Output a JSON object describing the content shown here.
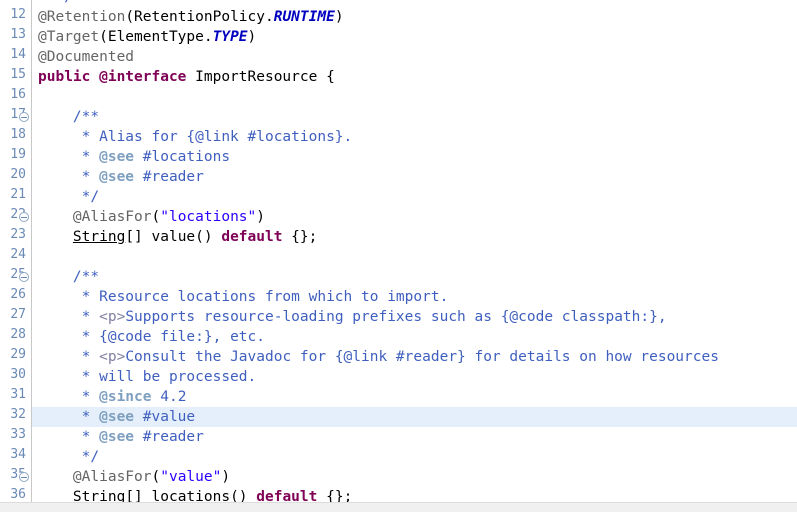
{
  "editor": {
    "name": "java-source-editor",
    "language": "Java",
    "font_size_px": 14.5,
    "line_height_px": 20,
    "current_line_number": "32",
    "colors": {
      "background": "#ffffff",
      "gutter_background": "#ffffff",
      "gutter_border": "#c8c8c8",
      "line_number": "#6a8ab5",
      "current_line_highlight": "#e4effb",
      "keyword": "#7f0055",
      "string": "#2a00ff",
      "annotation": "#646464",
      "static_field": "#0000c0",
      "comment": "#3f5fbf",
      "javadoc_tag": "#7f9fbf",
      "javadoc_html": "#7f7f9f",
      "plain_text": "#000000",
      "bottom_divider": "#f0f0f0"
    }
  },
  "lines": [
    {
      "number": "",
      "folding": false,
      "current": false,
      "clipped_top": true,
      "tokens": [
        {
          "t": "  ",
          "c": "plain"
        },
        {
          "t": "*/",
          "c": "comment"
        }
      ]
    },
    {
      "number": "12",
      "folding": false,
      "current": false,
      "tokens": [
        {
          "t": "@Retention",
          "c": "anno"
        },
        {
          "t": "(RetentionPolicy.",
          "c": "plain"
        },
        {
          "t": "RUNTIME",
          "c": "static"
        },
        {
          "t": ")",
          "c": "plain"
        }
      ]
    },
    {
      "number": "13",
      "folding": false,
      "current": false,
      "tokens": [
        {
          "t": "@Target",
          "c": "anno"
        },
        {
          "t": "(ElementType.",
          "c": "plain"
        },
        {
          "t": "TYPE",
          "c": "static"
        },
        {
          "t": ")",
          "c": "plain"
        }
      ]
    },
    {
      "number": "14",
      "folding": false,
      "current": false,
      "tokens": [
        {
          "t": "@Documented",
          "c": "anno"
        }
      ]
    },
    {
      "number": "15",
      "folding": false,
      "current": false,
      "tokens": [
        {
          "t": "public @interface",
          "c": "keyword"
        },
        {
          "t": " ImportResource {",
          "c": "plain"
        }
      ]
    },
    {
      "number": "16",
      "folding": false,
      "current": false,
      "tokens": []
    },
    {
      "number": "17",
      "folding": true,
      "current": false,
      "tokens": [
        {
          "t": "    /**",
          "c": "comment"
        }
      ]
    },
    {
      "number": "18",
      "folding": false,
      "current": false,
      "tokens": [
        {
          "t": "     * Alias for ",
          "c": "comment"
        },
        {
          "t": "{@link #locations}",
          "c": "jdlink"
        },
        {
          "t": ".",
          "c": "comment"
        }
      ]
    },
    {
      "number": "19",
      "folding": false,
      "current": false,
      "tokens": [
        {
          "t": "     * ",
          "c": "comment"
        },
        {
          "t": "@see",
          "c": "jdtag"
        },
        {
          "t": " #locations",
          "c": "comment"
        }
      ]
    },
    {
      "number": "20",
      "folding": false,
      "current": false,
      "tokens": [
        {
          "t": "     * ",
          "c": "comment"
        },
        {
          "t": "@see",
          "c": "jdtag"
        },
        {
          "t": " #reader",
          "c": "comment"
        }
      ]
    },
    {
      "number": "21",
      "folding": false,
      "current": false,
      "tokens": [
        {
          "t": "     */",
          "c": "comment"
        }
      ]
    },
    {
      "number": "22",
      "folding": true,
      "current": false,
      "tokens": [
        {
          "t": "    ",
          "c": "plain"
        },
        {
          "t": "@AliasFor",
          "c": "anno"
        },
        {
          "t": "(",
          "c": "plain"
        },
        {
          "t": "\"locations\"",
          "c": "string"
        },
        {
          "t": ")",
          "c": "plain"
        }
      ]
    },
    {
      "number": "23",
      "folding": false,
      "current": false,
      "tokens": [
        {
          "t": "    ",
          "c": "plain"
        },
        {
          "t": "String",
          "c": "type-link"
        },
        {
          "t": "[] value() ",
          "c": "plain"
        },
        {
          "t": "default",
          "c": "keyword"
        },
        {
          "t": " {};",
          "c": "plain"
        }
      ]
    },
    {
      "number": "24",
      "folding": false,
      "current": false,
      "tokens": []
    },
    {
      "number": "25",
      "folding": true,
      "current": false,
      "tokens": [
        {
          "t": "    /**",
          "c": "comment"
        }
      ]
    },
    {
      "number": "26",
      "folding": false,
      "current": false,
      "tokens": [
        {
          "t": "     * Resource locations from which to import.",
          "c": "comment"
        }
      ]
    },
    {
      "number": "27",
      "folding": false,
      "current": false,
      "tokens": [
        {
          "t": "     * ",
          "c": "comment"
        },
        {
          "t": "<p>",
          "c": "jdhtml"
        },
        {
          "t": "Supports resource-loading prefixes such as ",
          "c": "comment"
        },
        {
          "t": "{@code classpath:}",
          "c": "jdlink"
        },
        {
          "t": ",",
          "c": "comment"
        }
      ]
    },
    {
      "number": "28",
      "folding": false,
      "current": false,
      "tokens": [
        {
          "t": "     * ",
          "c": "comment"
        },
        {
          "t": "{@code file:}",
          "c": "jdlink"
        },
        {
          "t": ", etc.",
          "c": "comment"
        }
      ]
    },
    {
      "number": "29",
      "folding": false,
      "current": false,
      "tokens": [
        {
          "t": "     * ",
          "c": "comment"
        },
        {
          "t": "<p>",
          "c": "jdhtml"
        },
        {
          "t": "Consult the Javadoc for ",
          "c": "comment"
        },
        {
          "t": "{@link #reader}",
          "c": "jdlink"
        },
        {
          "t": " for details on how resources",
          "c": "comment"
        }
      ]
    },
    {
      "number": "30",
      "folding": false,
      "current": false,
      "tokens": [
        {
          "t": "     * will be processed.",
          "c": "comment"
        }
      ]
    },
    {
      "number": "31",
      "folding": false,
      "current": false,
      "tokens": [
        {
          "t": "     * ",
          "c": "comment"
        },
        {
          "t": "@since",
          "c": "jdtag"
        },
        {
          "t": " 4.2",
          "c": "comment"
        }
      ]
    },
    {
      "number": "32",
      "folding": false,
      "current": true,
      "tokens": [
        {
          "t": "     * ",
          "c": "comment"
        },
        {
          "t": "@see",
          "c": "jdtag"
        },
        {
          "t": " #value",
          "c": "comment"
        }
      ]
    },
    {
      "number": "33",
      "folding": false,
      "current": false,
      "tokens": [
        {
          "t": "     * ",
          "c": "comment"
        },
        {
          "t": "@see",
          "c": "jdtag"
        },
        {
          "t": " #reader",
          "c": "comment"
        }
      ]
    },
    {
      "number": "34",
      "folding": false,
      "current": false,
      "tokens": [
        {
          "t": "     */",
          "c": "comment"
        }
      ]
    },
    {
      "number": "35",
      "folding": true,
      "current": false,
      "tokens": [
        {
          "t": "    ",
          "c": "plain"
        },
        {
          "t": "@AliasFor",
          "c": "anno"
        },
        {
          "t": "(",
          "c": "plain"
        },
        {
          "t": "\"value\"",
          "c": "string"
        },
        {
          "t": ")",
          "c": "plain"
        }
      ]
    },
    {
      "number": "36",
      "folding": false,
      "current": false,
      "tokens": [
        {
          "t": "    ",
          "c": "plain"
        },
        {
          "t": "String",
          "c": "type-link"
        },
        {
          "t": "[] locations() ",
          "c": "plain"
        },
        {
          "t": "default",
          "c": "keyword"
        },
        {
          "t": " {};",
          "c": "plain"
        }
      ]
    }
  ]
}
